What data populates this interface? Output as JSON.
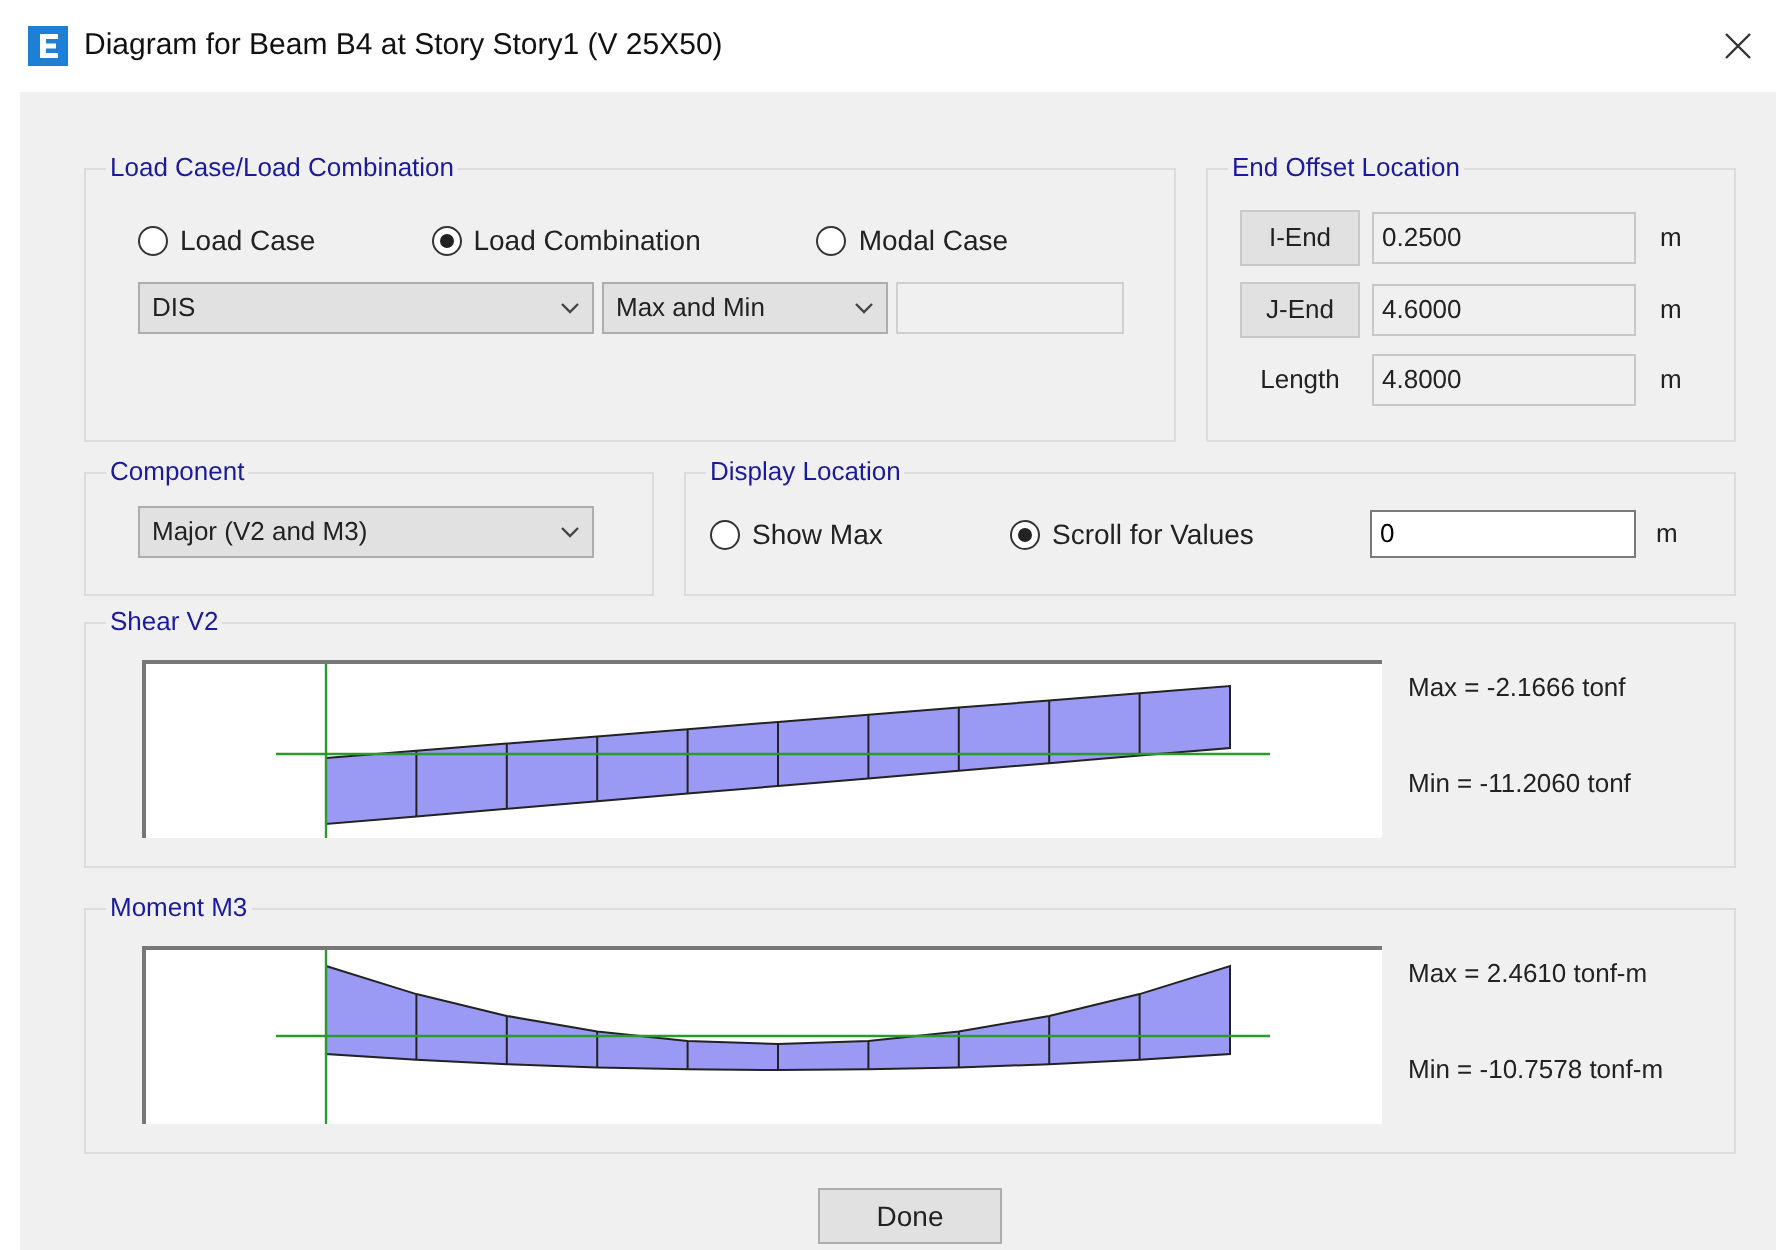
{
  "window": {
    "title": "Diagram for Beam B4 at Story Story1 (V 25X50)"
  },
  "load_case": {
    "title": "Load Case/Load Combination",
    "options": [
      {
        "label": "Load Case",
        "selected": false
      },
      {
        "label": "Load Combination",
        "selected": true
      },
      {
        "label": "Modal Case",
        "selected": false
      }
    ],
    "case_select": "DIS",
    "mode_select": "Max and Min"
  },
  "end_offset": {
    "title": "End Offset Location",
    "rows": [
      {
        "kind": "button",
        "label": "I-End",
        "value": "0.2500",
        "unit": "m"
      },
      {
        "kind": "button",
        "label": "J-End",
        "value": "4.6000",
        "unit": "m"
      },
      {
        "kind": "label",
        "label": "Length",
        "value": "4.8000",
        "unit": "m"
      }
    ]
  },
  "component": {
    "title": "Component",
    "select": "Major (V2 and M3)"
  },
  "display_location": {
    "title": "Display Location",
    "options": [
      {
        "label": "Show Max",
        "selected": false
      },
      {
        "label": "Scroll for Values",
        "selected": true
      }
    ],
    "value": "0",
    "unit": "m"
  },
  "diagrams": [
    {
      "kind": "shear",
      "title": "Shear V2",
      "max": "Max = -2.1666 tonf",
      "min": "Min = -11.2060 tonf"
    },
    {
      "kind": "moment",
      "title": "Moment M3",
      "max": "Max = 2.4610 tonf-m",
      "min": "Min = -10.7578 tonf-m"
    }
  ],
  "buttons": [
    "Done"
  ]
}
